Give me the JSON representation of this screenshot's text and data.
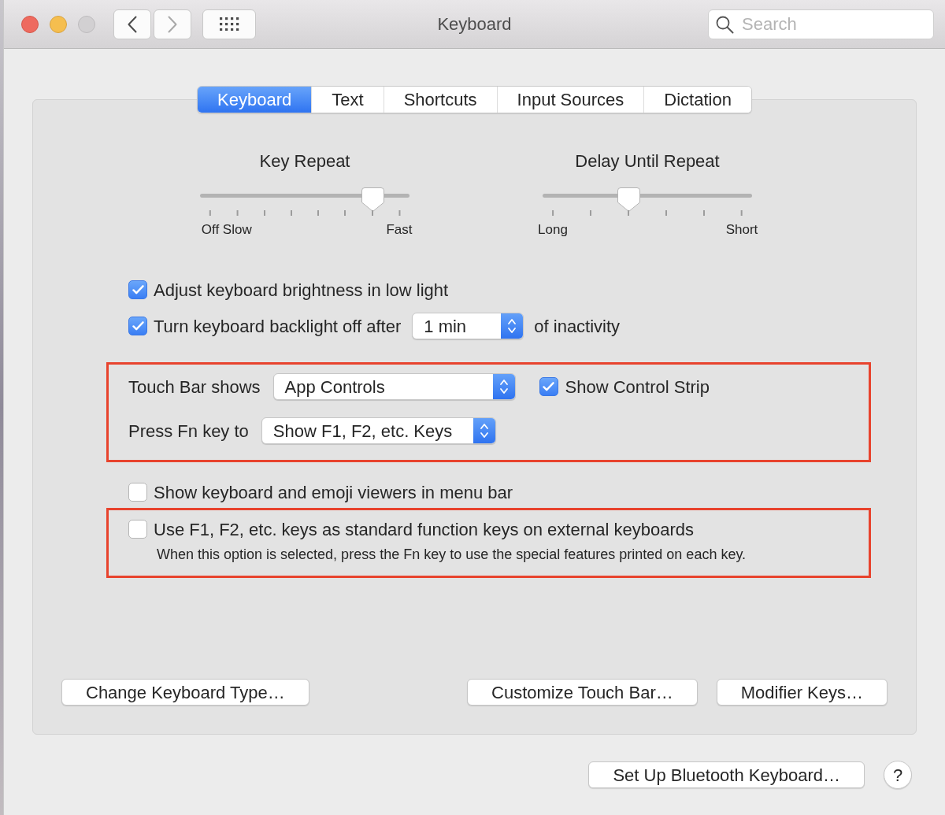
{
  "window": {
    "title": "Keyboard",
    "zoom_enabled": false,
    "back_enabled": true,
    "forward_enabled": false,
    "search": {
      "placeholder": "Search"
    }
  },
  "tabs": [
    {
      "label": "Keyboard",
      "selected": true
    },
    {
      "label": "Text",
      "selected": false
    },
    {
      "label": "Shortcuts",
      "selected": false
    },
    {
      "label": "Input Sources",
      "selected": false
    },
    {
      "label": "Dictation",
      "selected": false
    }
  ],
  "sliders": [
    {
      "label": "Key Repeat",
      "level": 0.86,
      "ticks": [
        {
          "kind": "labeled",
          "label": "Off"
        },
        {
          "kind": "labeled",
          "label": "Slow"
        },
        {
          "kind": "plain"
        },
        {
          "kind": "plain"
        },
        {
          "kind": "plain"
        },
        {
          "kind": "plain"
        },
        {
          "kind": "plain"
        },
        {
          "kind": "labeled",
          "label": "Fast"
        }
      ]
    },
    {
      "label": "Delay Until Repeat",
      "level": 0.4,
      "ticks": [
        {
          "kind": "labeled",
          "label": "Long"
        },
        {
          "kind": "plain"
        },
        {
          "kind": "plain"
        },
        {
          "kind": "plain"
        },
        {
          "kind": "plain"
        },
        {
          "kind": "labeled",
          "label": "Short"
        }
      ]
    }
  ],
  "options": [
    {
      "kind": "checkbox",
      "label": "Adjust keyboard brightness in low light",
      "checked": true
    },
    {
      "kind": "checkbox_popup",
      "label": "Turn keyboard backlight off after",
      "checked": true,
      "popup": "1 min",
      "suffix": "of inactivity"
    }
  ],
  "touch_bar": {
    "highlighted": true,
    "rows": [
      {
        "label": "Touch Bar shows",
        "popup": "App Controls",
        "checkbox": {
          "label": "Show Control Strip",
          "checked": true
        }
      },
      {
        "label": "Press Fn key to",
        "popup": "Show F1, F2, etc. Keys"
      }
    ]
  },
  "menu_bar_option": {
    "label": "Show keyboard and emoji viewers in menu bar",
    "checked": false
  },
  "function_keys": {
    "highlighted": true,
    "label": "Use F1, F2, etc. keys as standard function keys on external keyboards",
    "checked": false,
    "note": "When this option is selected, press the Fn key to use the special features printed on each key."
  },
  "panel_buttons": {
    "left": [
      "Change Keyboard Type…"
    ],
    "right": [
      "Customize Touch Bar…",
      "Modifier Keys…"
    ]
  },
  "footer": {
    "button": "Set Up Bluetooth Keyboard…",
    "help": "?"
  }
}
